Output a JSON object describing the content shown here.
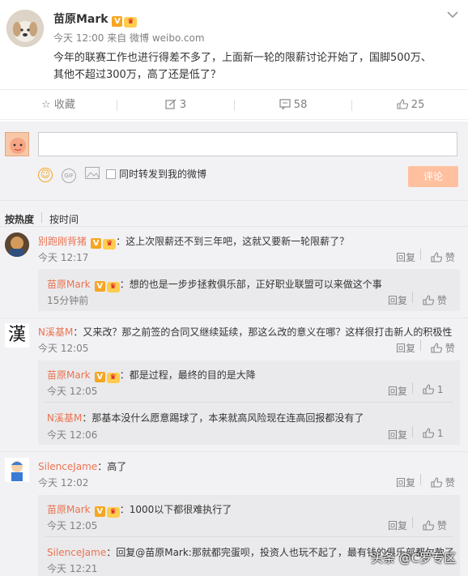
{
  "post": {
    "author": "苗原Mark",
    "meta": "今天 12:00 来自 微博 weibo.com",
    "text_line1": "今年的联赛工作也进行得差不多了，上面新一轮的限薪讨论开始了，国脚500万、",
    "text_line2": "其他不超过300万，高了还是低了？"
  },
  "actions": {
    "favorite": "收藏",
    "repost": "3",
    "comment": "58",
    "like": "25"
  },
  "composer": {
    "placeholder": "",
    "forward_label": "同时转发到我的微博",
    "submit_label": "评论"
  },
  "sort": {
    "hot": "按热度",
    "time": "按时间"
  },
  "labels": {
    "reply": "回复",
    "like": "赞",
    "vip": "V"
  },
  "comments": [
    {
      "name": "别跑刚背猪",
      "text": "：这上次限薪还不到三年吧，这就又要新一轮限薪了？",
      "time": "今天 12:17",
      "likes": "赞"
    },
    {
      "name": "苗原Mark",
      "text": "：想的也是一步步拯救俱乐部，正好职业联盟可以来做这个事",
      "time": "15分钟前",
      "likes": "赞"
    },
    {
      "name": "N溪基M",
      "text": "：又来改？那之前签的合同又继续延续，那这么改的意义在哪？这样很打击新人的积极性",
      "time": "今天 12:05",
      "likes": "赞"
    },
    {
      "name": "苗原Mark",
      "text": "：都是过程，最终的目的是大降",
      "time": "今天 12:05",
      "likes": "1"
    },
    {
      "name": "N溪基M",
      "text": "：那基本没什么愿意踢球了，本来就高风险现在连高回报都没有了",
      "time": "今天 12:06",
      "likes": "1"
    },
    {
      "name": "SilenceJame",
      "text": "：高了",
      "time": "今天 12:02",
      "likes": "赞"
    },
    {
      "name": "苗原Mark",
      "text": "：1000以下都很难执行了",
      "time": "今天 12:05",
      "likes": "赞"
    },
    {
      "name": "SilenceJame",
      "text": "：回复@苗原Mark:那就都完蛋呗，投资人也玩不起了，最有钱的俱乐部都欠款了",
      "time": "今天 12:21",
      "likes": ""
    }
  ],
  "watermark": "头条 @C罗专区",
  "colors": {
    "accent": "#eb7350",
    "panel_bg": "#f2f2f5",
    "reply_bg": "#eaeaec"
  }
}
